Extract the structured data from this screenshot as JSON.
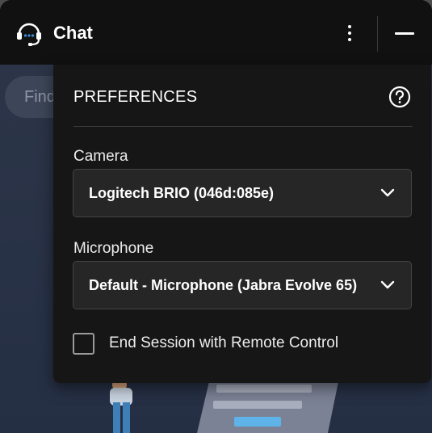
{
  "header": {
    "title": "Chat",
    "app_icon": "headset-chat-icon",
    "menu_icon": "kebab-menu-icon",
    "minimize_icon": "minimize-icon"
  },
  "background": {
    "search_placeholder": "Find"
  },
  "preferences": {
    "title": "PREFERENCES",
    "help_icon": "help-circle-icon",
    "camera": {
      "label": "Camera",
      "value": "Logitech BRIO (046d:085e)"
    },
    "microphone": {
      "label": "Microphone",
      "value": "Default - Microphone (Jabra Evolve 65)"
    },
    "end_session": {
      "label": "End Session with Remote Control",
      "checked": false
    }
  },
  "colors": {
    "panel_bg": "#161616",
    "titlebar_bg": "#111111",
    "content_bg": "#2c3548",
    "headset_accent": "#3b8edb"
  }
}
